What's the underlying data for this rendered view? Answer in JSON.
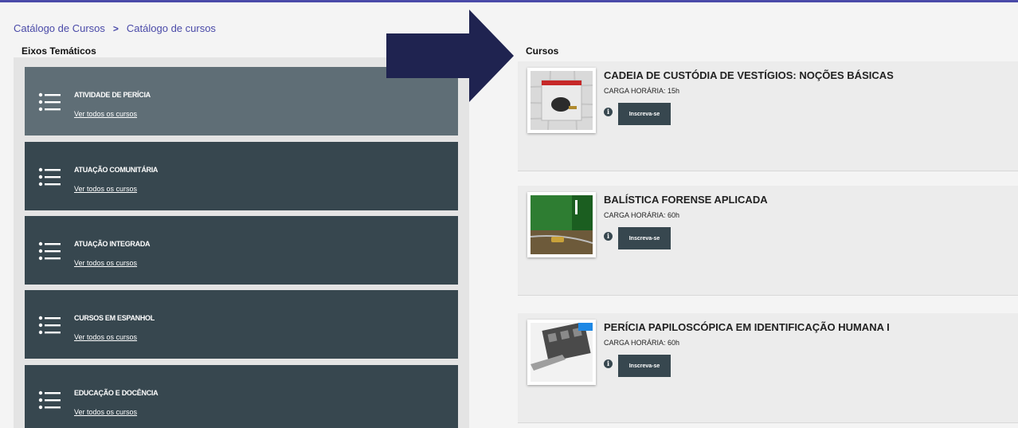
{
  "breadcrumb": {
    "items": [
      "Catálogo de Cursos",
      "Catálogo de cursos"
    ],
    "separator": ">"
  },
  "left": {
    "title": "Eixos Temáticos",
    "axes": [
      {
        "label": "ATIVIDADE DE PERÍCIA",
        "link": "Ver todos os cursos"
      },
      {
        "label": "ATUAÇÃO COMUNITÁRIA",
        "link": "Ver todos os cursos"
      },
      {
        "label": "ATUAÇÃO INTEGRADA",
        "link": "Ver todos os cursos"
      },
      {
        "label": "CURSOS EM ESPANHOL",
        "link": "Ver todos os cursos"
      },
      {
        "label": "EDUCAÇÃO E DOCÊNCIA",
        "link": "Ver todos os cursos"
      }
    ]
  },
  "right": {
    "title": "Cursos",
    "courses": [
      {
        "title": "CADEIA DE CUSTÓDIA DE VESTÍGIOS: NOÇÕES BÁSICAS",
        "hours": "CARGA HORÁRIA: 15h",
        "button": "Inscreva-se",
        "info": "i"
      },
      {
        "title": "BALÍSTICA FORENSE APLICADA",
        "hours": "CARGA HORÁRIA: 60h",
        "button": "Inscreva-se",
        "info": "i"
      },
      {
        "title": "PERÍCIA PAPILOSCÓPICA EM IDENTIFICAÇÃO HUMANA I",
        "hours": "CARGA HORÁRIA: 60h",
        "button": "Inscreva-se",
        "info": "i"
      }
    ]
  },
  "colors": {
    "accent": "#4a4aa8",
    "card_dark": "#37474f",
    "card_active": "#5f6e76",
    "arrow": "#1f2350"
  }
}
